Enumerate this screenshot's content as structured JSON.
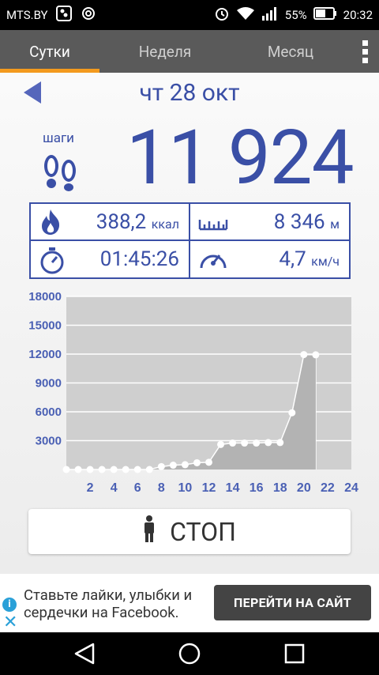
{
  "status_bar": {
    "carrier": "MTS.BY",
    "battery_percent": "55%",
    "time": "20:32"
  },
  "tabs": [
    {
      "label": "Сутки",
      "active": true
    },
    {
      "label": "Неделя",
      "active": false
    },
    {
      "label": "Месяц",
      "active": false
    }
  ],
  "day": {
    "date": "чт 28 окт",
    "steps_label": "шаги",
    "steps_value": "11 924"
  },
  "stats": {
    "calories_value": "388,2",
    "calories_unit": "ккал",
    "distance_value": "8 346",
    "distance_unit": "м",
    "duration_value": "01:45:26",
    "speed_value": "4,7",
    "speed_unit": "км/ч"
  },
  "chart_data": {
    "type": "area",
    "x": [
      0,
      1,
      2,
      3,
      4,
      5,
      6,
      7,
      8,
      9,
      10,
      11,
      12,
      13,
      14,
      15,
      16,
      17,
      18,
      19,
      20,
      21
    ],
    "values": [
      0,
      0,
      0,
      0,
      0,
      0,
      0,
      0,
      300,
      450,
      500,
      700,
      750,
      2600,
      2750,
      2750,
      2750,
      2800,
      2800,
      5900,
      11950,
      11924
    ],
    "x_ticks": [
      "2",
      "4",
      "6",
      "8",
      "10",
      "12",
      "14",
      "16",
      "18",
      "20",
      "22",
      "24"
    ],
    "y_ticks": [
      "18000",
      "15000",
      "12000",
      "9000",
      "6000",
      "3000"
    ],
    "xlim": [
      0,
      24
    ],
    "ylim": [
      0,
      18000
    ],
    "grid": true,
    "colors": {
      "plot_bg": "#cfcfcf",
      "fill": "#b3b3b3",
      "line": "#ffffff",
      "tick_text": "#4a60b4"
    }
  },
  "stop_button": {
    "label": "СТОП"
  },
  "ad": {
    "text": "Ставьте лайки, улыбки и сердечки на Facebook.",
    "button_label": "ПЕРЕЙТИ НА САЙТ"
  },
  "colors": {
    "accent": "#f39a1e",
    "primary_text": "#3a4fa6",
    "tab_bar": "#5a5a5a"
  }
}
